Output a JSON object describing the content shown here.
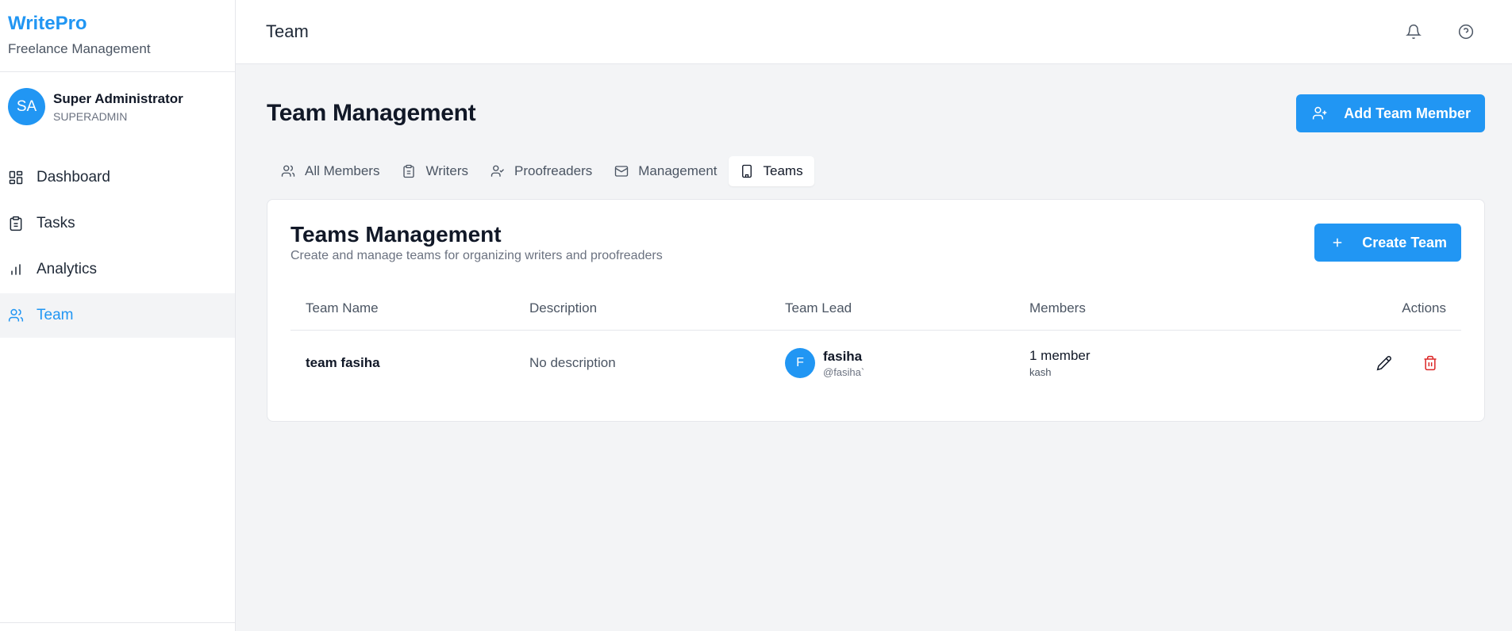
{
  "brand": {
    "title": "WritePro",
    "subtitle": "Freelance Management"
  },
  "user": {
    "initials": "SA",
    "name": "Super Administrator",
    "role": "SUPERADMIN"
  },
  "nav": [
    {
      "label": "Dashboard",
      "icon": "layout-grid-icon"
    },
    {
      "label": "Tasks",
      "icon": "clipboard-icon"
    },
    {
      "label": "Analytics",
      "icon": "bar-chart-icon"
    },
    {
      "label": "Team",
      "icon": "users-icon",
      "active": true
    }
  ],
  "topbar": {
    "title": "Team",
    "icons": [
      "bell-icon",
      "help-circle-icon"
    ]
  },
  "page": {
    "title": "Team Management",
    "add_button": "Add Team Member"
  },
  "tabs": [
    {
      "label": "All Members",
      "icon": "users-icon"
    },
    {
      "label": "Writers",
      "icon": "clipboard-icon"
    },
    {
      "label": "Proofreaders",
      "icon": "user-check-icon"
    },
    {
      "label": "Management",
      "icon": "mail-icon"
    },
    {
      "label": "Teams",
      "icon": "building-icon",
      "active": true
    }
  ],
  "card": {
    "title": "Teams Management",
    "subtitle": "Create and manage teams for organizing writers and proofreaders",
    "create_button": "Create Team"
  },
  "table": {
    "headers": [
      "Team Name",
      "Description",
      "Team Lead",
      "Members",
      "Actions"
    ],
    "rows": [
      {
        "name": "team fasiha",
        "description": "No description",
        "lead": {
          "initial": "F",
          "name": "fasiha",
          "handle": "@fasiha`"
        },
        "members": {
          "count": "1 member",
          "names": "kash"
        }
      }
    ]
  },
  "colors": {
    "accent": "#2196f3",
    "danger": "#dc2626",
    "sidebar_active_bg": "#f3f4f6"
  }
}
